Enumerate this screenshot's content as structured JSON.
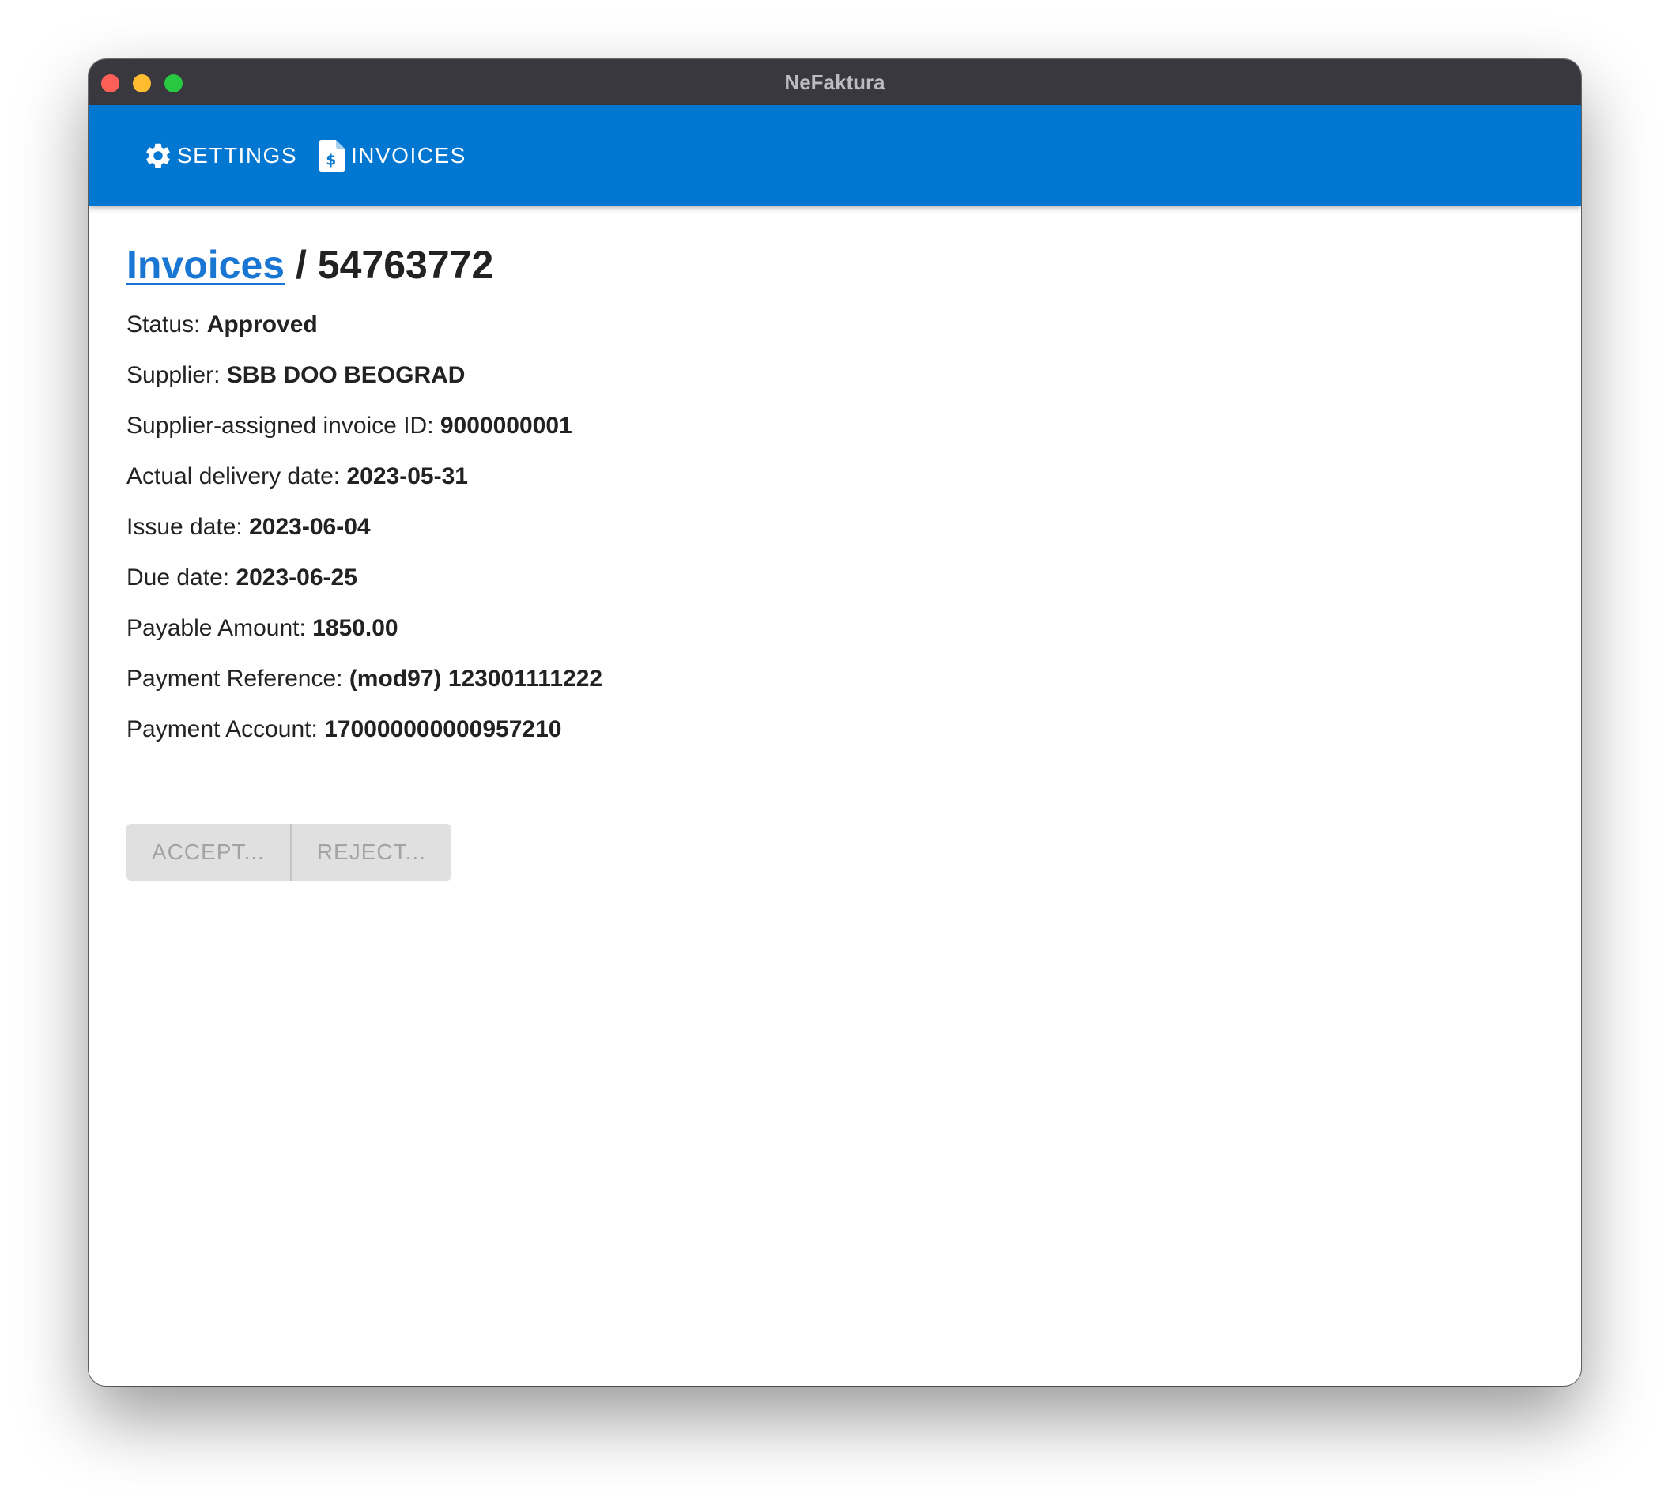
{
  "window": {
    "title": "NeFaktura"
  },
  "appbar": {
    "settings_label": "SETTINGS",
    "invoices_label": "INVOICES",
    "settings_icon": "gear-icon",
    "invoices_icon": "invoice-dollar-icon"
  },
  "breadcrumb": {
    "link": "Invoices",
    "separator": " / ",
    "current": "54763772"
  },
  "fields": [
    {
      "label": "Status: ",
      "value": "Approved"
    },
    {
      "label": "Supplier: ",
      "value": "SBB DOO BEOGRAD"
    },
    {
      "label": "Supplier-assigned invoice ID: ",
      "value": "9000000001"
    },
    {
      "label": "Actual delivery date: ",
      "value": "2023-05-31"
    },
    {
      "label": "Issue date: ",
      "value": "2023-06-04"
    },
    {
      "label": "Due date: ",
      "value": "2023-06-25"
    },
    {
      "label": "Payable Amount: ",
      "value": "1850.00"
    },
    {
      "label": "Payment Reference: ",
      "value": "(mod97) 123001111222"
    },
    {
      "label": "Payment Account: ",
      "value": "170000000000957210"
    }
  ],
  "actions": {
    "accept_label": "ACCEPT...",
    "reject_label": "REJECT...",
    "disabled": true
  },
  "colors": {
    "appbar": "#0277d1",
    "titlebar": "#3a383f",
    "link": "#1976d2"
  }
}
